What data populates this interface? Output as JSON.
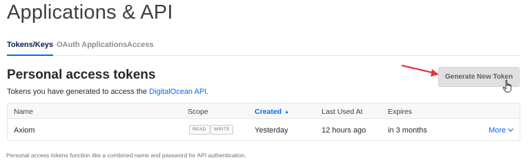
{
  "header": {
    "title": "Applications & API"
  },
  "tabs": [
    {
      "label": "Tokens/Keys",
      "active": true
    },
    {
      "label": "OAuth Applications",
      "active": false
    },
    {
      "label": "Access",
      "active": false
    }
  ],
  "section": {
    "title": "Personal access tokens",
    "description_prefix": "Tokens you have generated to access the ",
    "description_link": "DigitalOcean API",
    "description_suffix": ".",
    "generate_button": "Generate New Token"
  },
  "table": {
    "columns": [
      "Name",
      "Scope",
      "Created",
      "Last Used At",
      "Expires"
    ],
    "sorted_column": "Created",
    "rows": [
      {
        "name": "Axiom",
        "scopes": [
          "READ",
          "WRITE"
        ],
        "created": "Yesterday",
        "last_used": "12 hours ago",
        "expires": "in 3 months",
        "more_label": "More"
      }
    ]
  },
  "footnote": "Personal access tokens function like a combined name and password for API authentication.",
  "colors": {
    "accent": "#0069ff",
    "annotation_arrow": "#e0393e",
    "button_bg": "#e0e0e0"
  },
  "icons": {
    "sort": "sort-ascending-icon",
    "more": "chevron-down-icon",
    "cursor": "hand-pointer-icon",
    "annotation": "red-arrow-icon"
  }
}
